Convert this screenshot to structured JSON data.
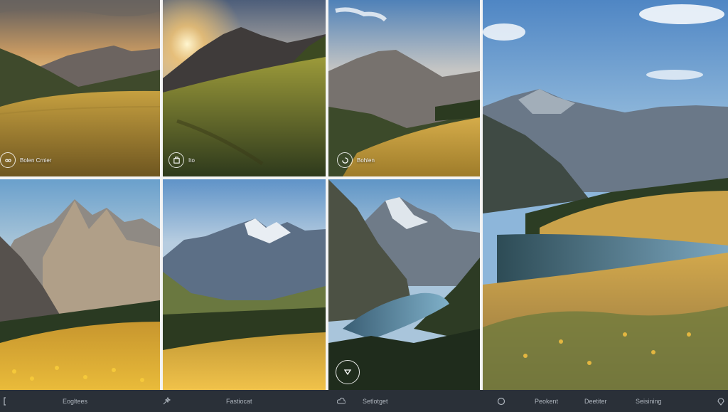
{
  "gallery": {
    "tiles": [
      {
        "caption": "Bolen Crnier",
        "icon": "infinity-icon"
      },
      {
        "caption": "Ito",
        "icon": "frame-icon"
      },
      {
        "caption": "Bohlen",
        "icon": "spinner-icon"
      },
      {
        "caption": ""
      },
      {
        "caption": ""
      },
      {
        "caption": "",
        "icon": "play-icon"
      },
      {
        "caption": ""
      }
    ]
  },
  "bottom_bar": {
    "items": [
      {
        "label": "",
        "icon": "bracket-icon"
      },
      {
        "label": "Eogltees",
        "icon": ""
      },
      {
        "label": "",
        "icon": "wand-icon"
      },
      {
        "label": "Fastiocat",
        "icon": ""
      },
      {
        "label": "Setlotget",
        "icon": "cloud-arrow-icon"
      },
      {
        "label": "",
        "icon": "circle-icon"
      },
      {
        "label": "Peokent",
        "icon": ""
      },
      {
        "label": "Deetiter",
        "icon": ""
      },
      {
        "label": "Seisining",
        "icon": ""
      },
      {
        "label": "",
        "icon": "pin-icon"
      }
    ]
  },
  "colors": {
    "bar_bg": "#2a3038",
    "bar_text": "#aeb5bd",
    "gutter": "#f4f4f4"
  }
}
